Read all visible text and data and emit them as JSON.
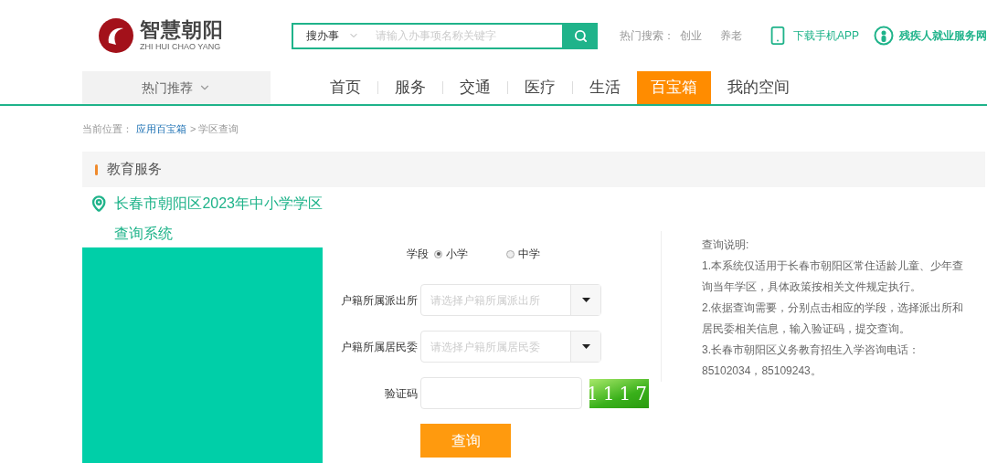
{
  "logo": {
    "name": "智慧朝阳",
    "pinyin": "ZHI HUI CHAO YANG"
  },
  "search": {
    "scope": "搜办事",
    "placeholder": "请输入办事项名称关键字"
  },
  "hot_search": {
    "label": "热门搜索：",
    "terms": [
      "创业",
      "养老"
    ]
  },
  "header_links": [
    {
      "kind": "phone",
      "label": "下载手机APP"
    },
    {
      "kind": "accessibility",
      "label": "残疾人就业服务网"
    }
  ],
  "hot_recommend": "热门推荐",
  "nav": [
    {
      "label": "首页",
      "selected": false
    },
    {
      "label": "服务",
      "selected": false
    },
    {
      "label": "交通",
      "selected": false
    },
    {
      "label": "医疗",
      "selected": false
    },
    {
      "label": "生活",
      "selected": false
    },
    {
      "label": "百宝箱",
      "selected": true
    },
    {
      "label": "我的空间",
      "selected": false
    }
  ],
  "breadcrumb": {
    "label": "当前位置：",
    "link": "应用百宝箱",
    "current": "> 学区查询"
  },
  "section_title": "教育服务",
  "system_title": [
    "长春市朝阳区2023年中小学学区",
    "查询系统"
  ],
  "form": {
    "stage_label": "学段",
    "stages": [
      {
        "label": "小学",
        "selected": true
      },
      {
        "label": "中学",
        "selected": false
      }
    ],
    "selects": [
      {
        "label": "户籍所属派出所",
        "placeholder": "请选择户籍所属派出所"
      },
      {
        "label": "户籍所属居民委",
        "placeholder": "请选择户籍所属居民委"
      }
    ],
    "captcha_label": "验证码",
    "captcha_text": "1117",
    "submit": "查询"
  },
  "instructions": {
    "title": "查询说明:",
    "items": [
      "1.本系统仅适用于长春市朝阳区常住适龄儿童、少年查询当年学区，具体政策按相关文件规定执行。",
      "2.依据查询需要，分别点击相应的学段，选择派出所和居民委相关信息，输入验证码，提交查询。",
      "3.长春市朝阳区义务教育招生入学咨询电话：85102034，85109243。"
    ]
  }
}
